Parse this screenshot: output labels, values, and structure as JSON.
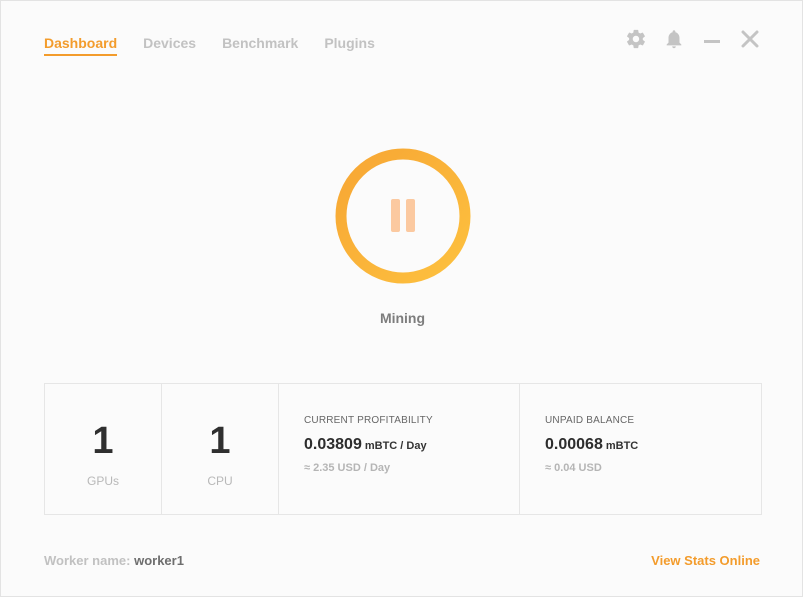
{
  "nav": {
    "tabs": [
      {
        "label": "Dashboard",
        "active": true
      },
      {
        "label": "Devices",
        "active": false
      },
      {
        "label": "Benchmark",
        "active": false
      },
      {
        "label": "Plugins",
        "active": false
      }
    ]
  },
  "controls": {
    "icons": [
      "gear-icon",
      "bell-icon",
      "minimize-icon",
      "close-icon"
    ]
  },
  "mining": {
    "status": "Mining",
    "icon": "pause-icon",
    "ring_color_start": "#f7a634",
    "ring_color_end": "#fdc13f",
    "pause_color": "#fbc9a0"
  },
  "stats": {
    "gpus": {
      "value": "1",
      "label": "GPUs"
    },
    "cpu": {
      "value": "1",
      "label": "CPU"
    },
    "profitability": {
      "heading": "CURRENT PROFITABILITY",
      "value": "0.03809",
      "unit": "mBTC / Day",
      "fiat": "≈ 2.35 USD / Day"
    },
    "balance": {
      "heading": "UNPAID BALANCE",
      "value": "0.00068",
      "unit": "mBTC",
      "fiat": "≈ 0.04 USD"
    }
  },
  "footer": {
    "worker_label": "Worker name:",
    "worker_value": "worker1",
    "stats_link": "View Stats Online"
  },
  "colors": {
    "accent": "#f39c2c",
    "muted": "#c2c2c2"
  }
}
